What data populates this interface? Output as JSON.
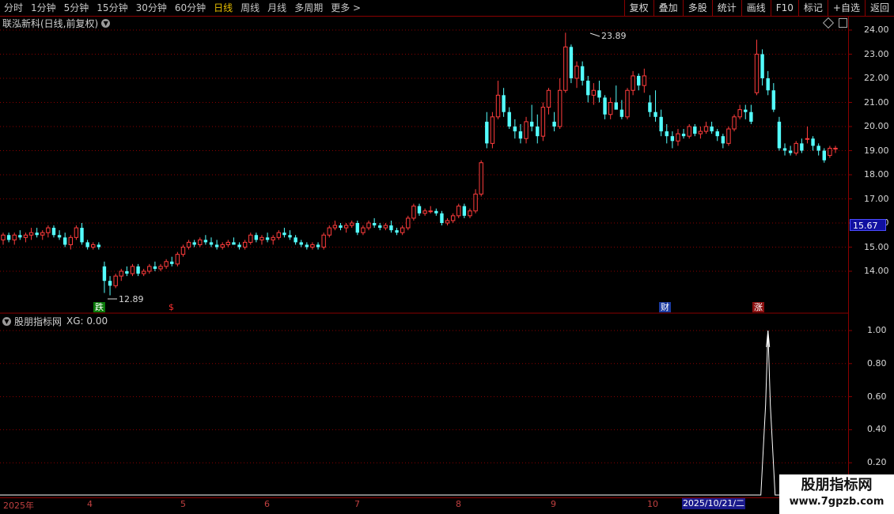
{
  "toolbar": {
    "periods": [
      "分时",
      "1分钟",
      "5分钟",
      "15分钟",
      "30分钟",
      "60分钟",
      "日线",
      "周线",
      "月线",
      "多周期",
      "更多 >"
    ],
    "active_period": "日线",
    "buttons": [
      "复权",
      "叠加",
      "多股",
      "统计",
      "画线",
      "F10",
      "标记",
      "+自选",
      "返回"
    ]
  },
  "main_chart": {
    "title": "联泓新科(日线,前复权)",
    "price_ticks": [
      "24.00",
      "23.00",
      "22.00",
      "21.00",
      "20.00",
      "19.00",
      "18.00",
      "17.00",
      "16.00",
      "15.00",
      "14.00"
    ],
    "current_price": "15.67",
    "high_label": "23.89",
    "low_label": "12.89",
    "markers": {
      "die": "跌",
      "dollar": "$",
      "cai": "财",
      "zhang": "涨"
    }
  },
  "indicator": {
    "title": "股朋指标网",
    "value_text": "XG: 0.00",
    "ticks": [
      "1.00",
      "0.80",
      "0.60",
      "0.40",
      "0.20"
    ]
  },
  "date_axis": {
    "labels": [
      "2025年",
      "4",
      "5",
      "6",
      "7",
      "8",
      "9",
      "10"
    ],
    "highlight": "2025/10/21/二"
  },
  "watermark": {
    "line1": "股朋指标网",
    "line2": "www.7gpzb.com"
  },
  "colors": {
    "up": "#ff3c3c",
    "down": "#54ffff",
    "grid": "#8a0000",
    "highlight": "#1a1a8c"
  },
  "chart_data": {
    "type": "candlestick",
    "ylim": [
      13.0,
      24.3
    ],
    "candles": [
      [
        15.3,
        15.6,
        15.1,
        15.5
      ],
      [
        15.5,
        15.6,
        15.2,
        15.3
      ],
      [
        15.3,
        15.6,
        15.1,
        15.5
      ],
      [
        15.5,
        15.7,
        15.3,
        15.4
      ],
      [
        15.4,
        15.6,
        15.2,
        15.5
      ],
      [
        15.5,
        15.8,
        15.3,
        15.6
      ],
      [
        15.6,
        15.8,
        15.4,
        15.5
      ],
      [
        15.5,
        15.7,
        15.3,
        15.6
      ],
      [
        15.6,
        15.9,
        15.4,
        15.8
      ],
      [
        15.8,
        15.9,
        15.4,
        15.5
      ],
      [
        15.5,
        15.7,
        15.3,
        15.4
      ],
      [
        15.4,
        15.6,
        15.0,
        15.1
      ],
      [
        15.1,
        15.5,
        14.9,
        15.4
      ],
      [
        15.4,
        15.9,
        15.3,
        15.8
      ],
      [
        15.8,
        16.0,
        15.1,
        15.2
      ],
      [
        15.2,
        15.3,
        14.9,
        15.0
      ],
      [
        15.0,
        15.2,
        14.9,
        15.1
      ],
      [
        15.1,
        15.2,
        14.9,
        15.0
      ],
      [
        14.2,
        14.4,
        13.1,
        13.6
      ],
      [
        13.6,
        13.8,
        13.0,
        13.4
      ],
      [
        13.4,
        13.9,
        13.3,
        13.8
      ],
      [
        13.8,
        14.1,
        13.6,
        14.0
      ],
      [
        14.0,
        14.2,
        13.8,
        13.9
      ],
      [
        13.9,
        14.3,
        13.8,
        14.2
      ],
      [
        14.2,
        14.3,
        13.8,
        13.9
      ],
      [
        13.9,
        14.1,
        13.8,
        14.0
      ],
      [
        14.0,
        14.3,
        13.9,
        14.2
      ],
      [
        14.2,
        14.4,
        14.0,
        14.1
      ],
      [
        14.1,
        14.3,
        14.0,
        14.2
      ],
      [
        14.2,
        14.5,
        14.1,
        14.4
      ],
      [
        14.4,
        14.6,
        14.2,
        14.3
      ],
      [
        14.3,
        14.8,
        14.2,
        14.7
      ],
      [
        14.7,
        15.1,
        14.6,
        15.0
      ],
      [
        15.0,
        15.3,
        14.9,
        15.2
      ],
      [
        15.2,
        15.3,
        15.0,
        15.1
      ],
      [
        15.1,
        15.4,
        15.0,
        15.3
      ],
      [
        15.3,
        15.5,
        15.1,
        15.2
      ],
      [
        15.2,
        15.4,
        15.0,
        15.1
      ],
      [
        15.1,
        15.3,
        14.9,
        15.0
      ],
      [
        15.0,
        15.2,
        14.9,
        15.1
      ],
      [
        15.1,
        15.3,
        15.0,
        15.2
      ],
      [
        15.2,
        15.4,
        15.1,
        15.1
      ],
      [
        15.1,
        15.2,
        14.9,
        15.0
      ],
      [
        15.0,
        15.3,
        14.9,
        15.2
      ],
      [
        15.2,
        15.6,
        15.1,
        15.5
      ],
      [
        15.5,
        15.6,
        15.2,
        15.3
      ],
      [
        15.3,
        15.5,
        15.1,
        15.4
      ],
      [
        15.4,
        15.6,
        15.2,
        15.3
      ],
      [
        15.3,
        15.5,
        15.1,
        15.4
      ],
      [
        15.4,
        15.7,
        15.3,
        15.6
      ],
      [
        15.6,
        15.8,
        15.4,
        15.5
      ],
      [
        15.5,
        15.7,
        15.3,
        15.4
      ],
      [
        15.4,
        15.5,
        15.1,
        15.2
      ],
      [
        15.2,
        15.3,
        15.0,
        15.1
      ],
      [
        15.1,
        15.2,
        14.9,
        15.0
      ],
      [
        15.0,
        15.2,
        14.9,
        15.1
      ],
      [
        15.1,
        15.2,
        14.9,
        15.0
      ],
      [
        15.0,
        15.6,
        14.9,
        15.5
      ],
      [
        15.5,
        15.9,
        15.4,
        15.8
      ],
      [
        15.8,
        16.1,
        15.7,
        15.9
      ],
      [
        15.9,
        16.0,
        15.7,
        15.8
      ],
      [
        15.8,
        16.0,
        15.6,
        15.9
      ],
      [
        15.9,
        16.1,
        15.8,
        16.0
      ],
      [
        16.0,
        16.1,
        15.5,
        15.6
      ],
      [
        15.6,
        15.9,
        15.5,
        15.8
      ],
      [
        15.8,
        16.1,
        15.7,
        16.0
      ],
      [
        16.0,
        16.2,
        15.8,
        15.9
      ],
      [
        15.9,
        16.0,
        15.7,
        15.8
      ],
      [
        15.8,
        16.0,
        15.7,
        15.9
      ],
      [
        15.9,
        16.1,
        15.6,
        15.7
      ],
      [
        15.7,
        15.8,
        15.5,
        15.6
      ],
      [
        15.6,
        15.9,
        15.5,
        15.8
      ],
      [
        15.8,
        16.3,
        15.7,
        16.2
      ],
      [
        16.2,
        16.8,
        16.1,
        16.7
      ],
      [
        16.7,
        16.8,
        16.3,
        16.4
      ],
      [
        16.4,
        16.6,
        16.3,
        16.5
      ],
      [
        16.5,
        16.7,
        16.4,
        16.5
      ],
      [
        16.5,
        16.6,
        16.3,
        16.4
      ],
      [
        16.4,
        16.5,
        15.9,
        16.0
      ],
      [
        16.0,
        16.2,
        15.9,
        16.1
      ],
      [
        16.1,
        16.4,
        16.0,
        16.3
      ],
      [
        16.3,
        16.8,
        16.2,
        16.7
      ],
      [
        16.7,
        16.8,
        16.2,
        16.3
      ],
      [
        16.3,
        16.6,
        16.2,
        16.5
      ],
      [
        16.5,
        17.4,
        16.4,
        17.2
      ],
      [
        17.2,
        18.6,
        17.1,
        18.5
      ],
      [
        20.2,
        20.6,
        19.1,
        19.3
      ],
      [
        19.3,
        20.6,
        19.1,
        20.4
      ],
      [
        20.4,
        21.9,
        20.3,
        21.3
      ],
      [
        21.3,
        21.6,
        20.4,
        20.6
      ],
      [
        20.6,
        20.8,
        19.9,
        20.0
      ],
      [
        20.0,
        20.3,
        19.5,
        19.8
      ],
      [
        19.8,
        20.1,
        19.3,
        19.5
      ],
      [
        19.5,
        20.4,
        19.3,
        20.2
      ],
      [
        20.2,
        20.9,
        19.8,
        20.0
      ],
      [
        20.0,
        20.5,
        19.3,
        19.6
      ],
      [
        19.6,
        21.0,
        19.4,
        20.8
      ],
      [
        20.8,
        21.6,
        20.5,
        21.5
      ],
      [
        20.2,
        20.6,
        19.8,
        20.0
      ],
      [
        20.0,
        22.0,
        19.9,
        21.5
      ],
      [
        21.5,
        23.89,
        21.4,
        23.3
      ],
      [
        23.3,
        23.4,
        21.8,
        22.0
      ],
      [
        22.0,
        22.7,
        21.6,
        22.5
      ],
      [
        22.5,
        22.7,
        21.7,
        21.9
      ],
      [
        21.9,
        22.1,
        21.0,
        21.3
      ],
      [
        21.3,
        21.8,
        20.9,
        21.5
      ],
      [
        21.5,
        21.9,
        21.0,
        21.2
      ],
      [
        21.2,
        21.3,
        20.3,
        20.5
      ],
      [
        20.5,
        21.2,
        20.3,
        21.0
      ],
      [
        21.0,
        21.7,
        20.8,
        20.7
      ],
      [
        20.7,
        21.1,
        20.3,
        20.4
      ],
      [
        20.4,
        21.6,
        20.3,
        21.5
      ],
      [
        21.5,
        22.3,
        21.3,
        22.1
      ],
      [
        22.1,
        22.2,
        21.5,
        21.7
      ],
      [
        21.7,
        22.4,
        21.4,
        22.1
      ],
      [
        21.0,
        21.3,
        20.4,
        20.6
      ],
      [
        20.6,
        21.5,
        20.2,
        20.4
      ],
      [
        20.4,
        20.7,
        19.6,
        19.8
      ],
      [
        19.8,
        20.1,
        19.3,
        19.6
      ],
      [
        19.6,
        19.8,
        19.1,
        19.4
      ],
      [
        19.4,
        19.9,
        19.2,
        19.7
      ],
      [
        19.7,
        19.9,
        19.5,
        19.6
      ],
      [
        19.6,
        20.1,
        19.5,
        20.0
      ],
      [
        20.0,
        20.1,
        19.6,
        19.7
      ],
      [
        19.7,
        20.0,
        19.5,
        19.8
      ],
      [
        19.8,
        20.2,
        19.7,
        20.0
      ],
      [
        20.0,
        20.2,
        19.7,
        19.8
      ],
      [
        19.8,
        19.9,
        19.4,
        19.6
      ],
      [
        19.6,
        19.7,
        19.1,
        19.3
      ],
      [
        19.3,
        20.0,
        19.2,
        19.9
      ],
      [
        19.9,
        20.5,
        19.8,
        20.4
      ],
      [
        20.4,
        20.9,
        20.3,
        20.7
      ],
      [
        20.7,
        20.9,
        20.3,
        20.6
      ],
      [
        20.6,
        20.9,
        20.1,
        20.2
      ],
      [
        21.4,
        23.6,
        21.3,
        23.0
      ],
      [
        23.0,
        23.2,
        21.7,
        22.0
      ],
      [
        22.0,
        22.3,
        21.3,
        21.5
      ],
      [
        21.5,
        21.8,
        20.6,
        20.7
      ],
      [
        20.2,
        20.4,
        19.0,
        19.1
      ],
      [
        19.1,
        19.3,
        18.8,
        19.0
      ],
      [
        19.0,
        19.2,
        18.8,
        18.9
      ],
      [
        18.9,
        19.4,
        18.8,
        19.3
      ],
      [
        19.3,
        19.5,
        18.9,
        19.0
      ],
      [
        19.5,
        20.0,
        19.3,
        19.5
      ],
      [
        19.5,
        19.6,
        19.0,
        19.2
      ],
      [
        19.2,
        19.3,
        18.8,
        19.0
      ],
      [
        19.0,
        19.1,
        18.5,
        18.6
      ],
      [
        18.8,
        19.2,
        18.7,
        19.1
      ],
      [
        19.1,
        19.2,
        18.9,
        19.1
      ]
    ],
    "xg_indicator": {
      "ylim": [
        0,
        1.0
      ],
      "signal_index": 136,
      "signal_value": 1.0
    }
  }
}
